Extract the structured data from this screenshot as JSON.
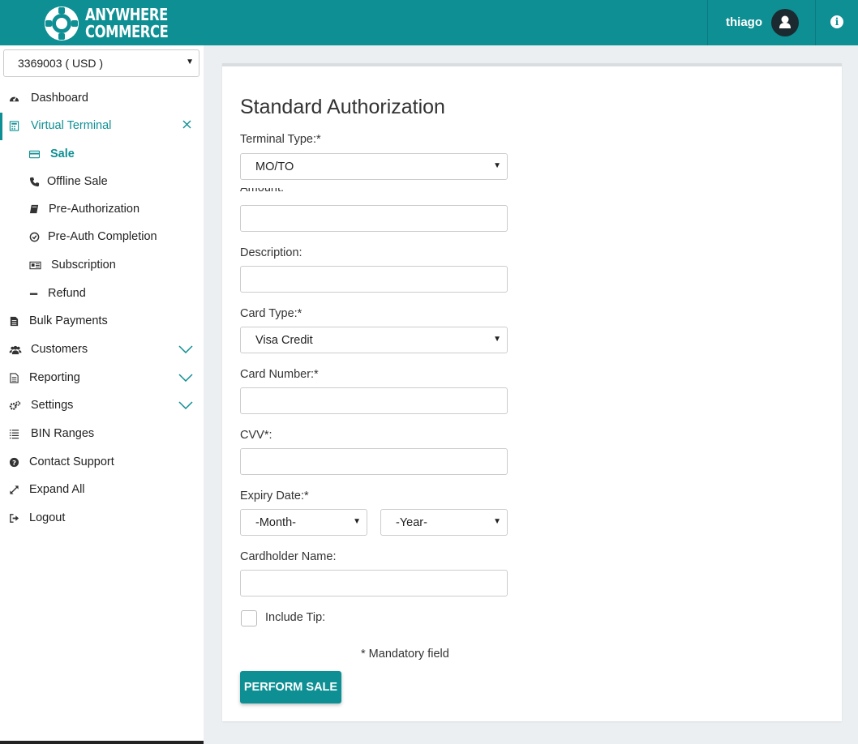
{
  "header": {
    "logo_line1": "ANYWHERE",
    "logo_line2": "COMMERCE",
    "user_name": "thiago",
    "brand_color": "#0e8f93"
  },
  "sidebar": {
    "account": "3369003 ( USD )",
    "items": [
      {
        "label": "Dashboard",
        "icon": "dashboard-icon"
      },
      {
        "label": "Virtual Terminal",
        "icon": "calculator-icon",
        "active": true
      },
      {
        "label": "Sale",
        "icon": "credit-card-icon",
        "sub": true,
        "active": true
      },
      {
        "label": "Offline Sale",
        "icon": "phone-icon",
        "sub": true
      },
      {
        "label": "Pre-Authorization",
        "icon": "book-icon",
        "sub": true
      },
      {
        "label": "Pre-Auth Completion",
        "icon": "check-circle-icon",
        "sub": true
      },
      {
        "label": "Subscription",
        "icon": "newspaper-icon",
        "sub": true
      },
      {
        "label": "Refund",
        "icon": "minus-icon",
        "sub": true
      },
      {
        "label": "Bulk Payments",
        "icon": "file-icon"
      },
      {
        "label": "Customers",
        "icon": "users-icon"
      },
      {
        "label": "Reporting",
        "icon": "file-text-icon"
      },
      {
        "label": "Settings",
        "icon": "cogs-icon"
      },
      {
        "label": "BIN Ranges",
        "icon": "list-icon"
      },
      {
        "label": "Contact Support",
        "icon": "question-circle-icon"
      },
      {
        "label": "Expand All",
        "icon": "expand-icon"
      },
      {
        "label": "Logout",
        "icon": "sign-out-icon"
      }
    ]
  },
  "form": {
    "title": "Standard Authorization",
    "terminal_type_label": "Terminal Type:*",
    "terminal_type_value": "MO/TO",
    "amount_label": "Amount:",
    "description_label": "Description:",
    "card_type_label": "Card Type:*",
    "card_type_value": "Visa Credit",
    "card_number_label": "Card Number:*",
    "cvv_label": "CVV*:",
    "expiry_label": "Expiry Date:*",
    "month_value": "-Month-",
    "year_value": "-Year-",
    "cardholder_label": "Cardholder Name:",
    "include_tip_label": "Include Tip:",
    "mandatory_note": "* Mandatory field",
    "submit_label": "PERFORM SALE"
  }
}
